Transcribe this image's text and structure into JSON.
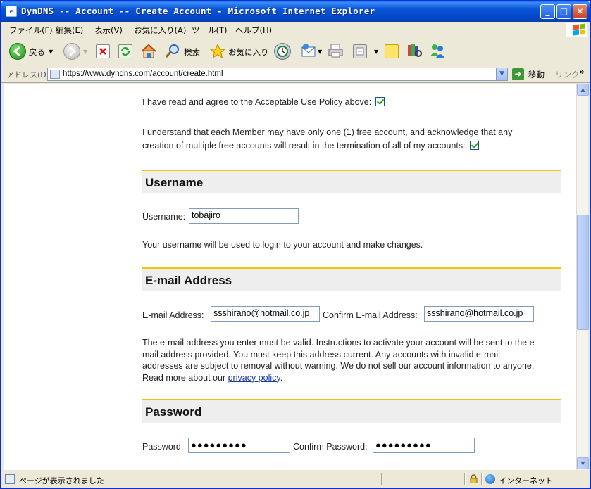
{
  "window": {
    "title": "DynDNS -- Account -- Create Account - Microsoft Internet Explorer",
    "minimize": "_",
    "maximize": "□",
    "close": "✕"
  },
  "menu": [
    "ファイル(F)",
    "編集(E)",
    "表示(V)",
    "お気に入り(A)",
    "ツール(T)",
    "ヘルプ(H)"
  ],
  "toolbar": {
    "back_label": "戻る",
    "search_label": "検索",
    "favorites_label": "お気に入り"
  },
  "address": {
    "label": "アドレス(D)",
    "url": "https://www.dyndns.com/account/create.html",
    "go_label": "移動",
    "links_label": "リンク"
  },
  "agreements": {
    "aup_text": "I have read and agree to the Acceptable Use Policy above:",
    "aup_checked": true,
    "free_line1": "I understand that each Member may have only one (1) free account, and acknowledge that any",
    "free_line2": "creation of multiple free accounts will result in the termination of all of my accounts:",
    "free_checked": true
  },
  "username_section": {
    "heading": "Username",
    "label": "Username:",
    "value": "tobajiro",
    "note": "Your username will be used to login to your account and make changes."
  },
  "email_section": {
    "heading": "E-mail Address",
    "label": "E-mail Address:",
    "value": "ssshirano@hotmail.co.jp",
    "confirm_label": "Confirm E-mail Address:",
    "confirm_value": "ssshirano@hotmail.co.jp",
    "note_line1": "The e-mail address you enter must be valid. Instructions to activate your account will be sent to the e-",
    "note_line2": "mail address provided. You must keep this address current. Any accounts with invalid e-mail",
    "note_line3": "addresses are subject to removal without warning. We do not sell our account information to anyone.",
    "note_line4_prefix": "Read more about our ",
    "privacy_link": "privacy policy",
    "note_line4_suffix": "."
  },
  "password_section": {
    "heading": "Password",
    "label": "Password:",
    "value": "●●●●●●●●●",
    "confirm_label": "Confirm Password:",
    "confirm_value": "●●●●●●●●●"
  },
  "status": {
    "text": "ページが表示されました",
    "zone": "インターネット"
  },
  "colors": {
    "section_rule": "#f5c400",
    "section_bg": "#eeeeee",
    "title_bar": "#0a56d6"
  }
}
